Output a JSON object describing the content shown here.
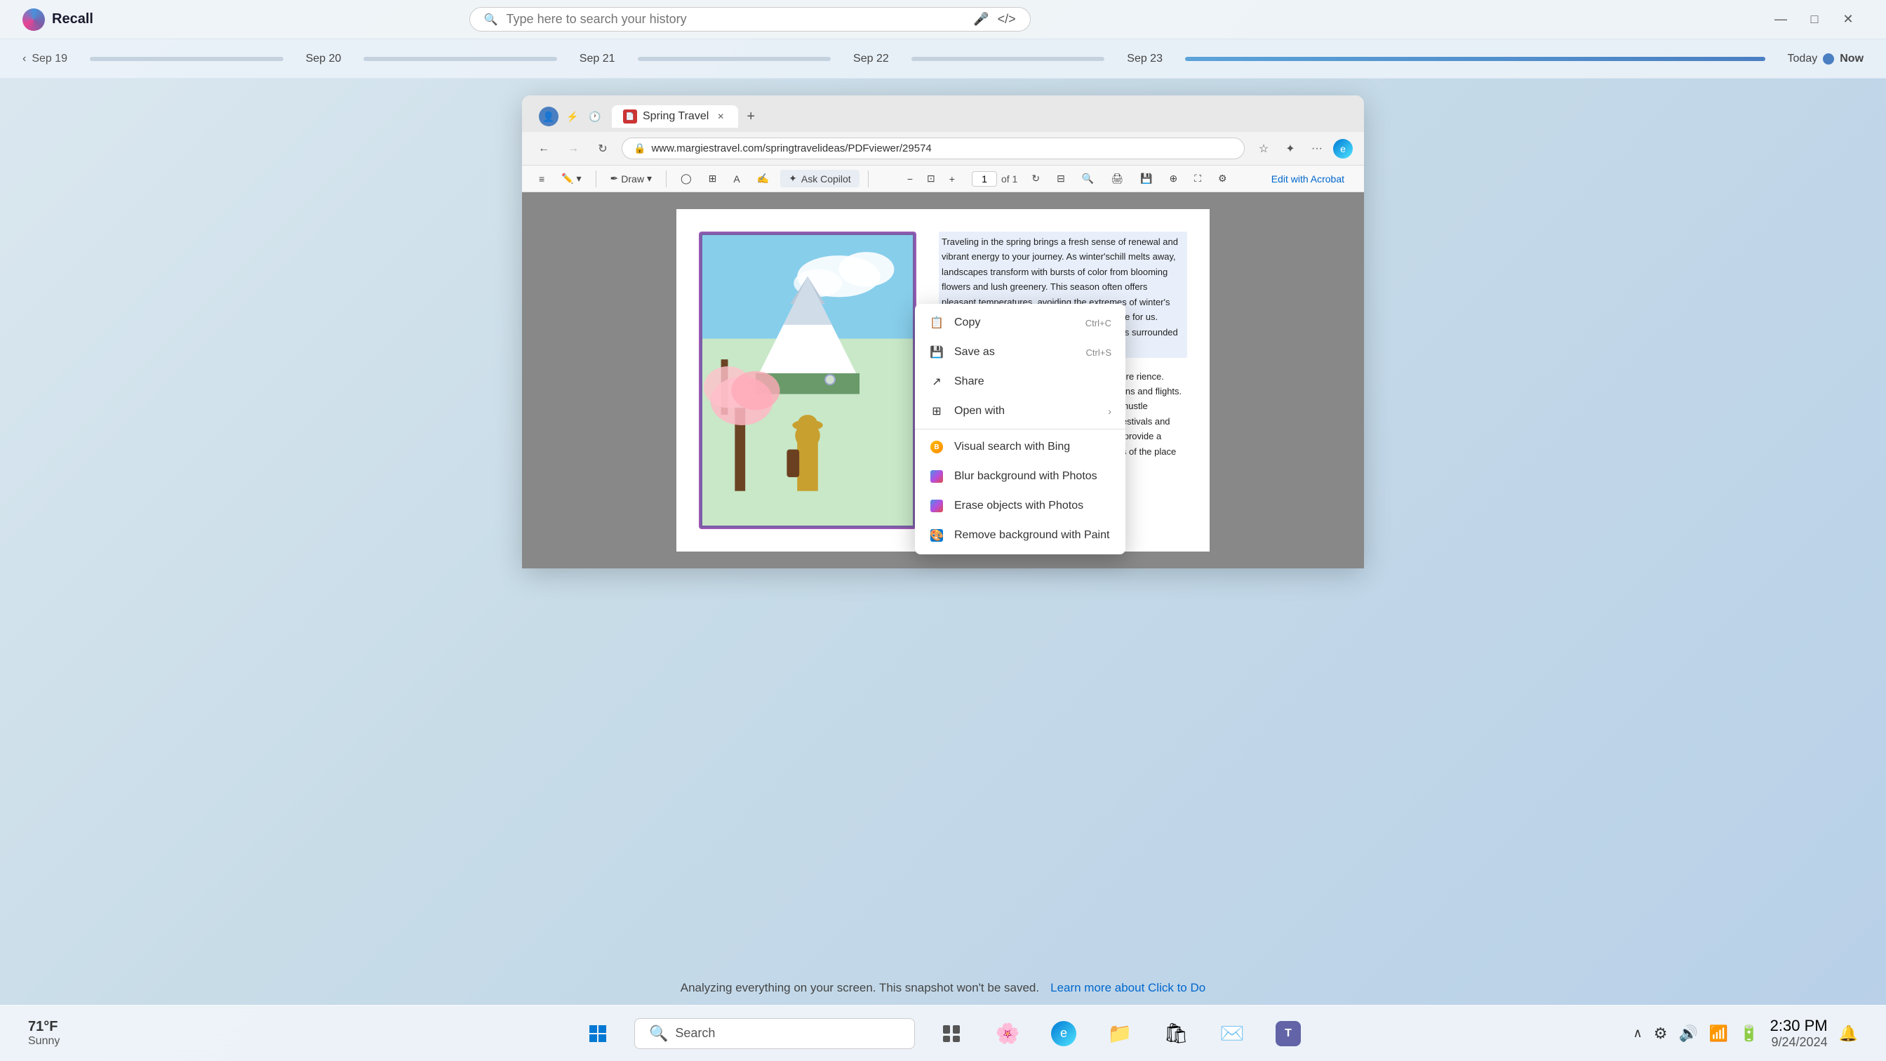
{
  "app": {
    "title": "Recall",
    "search_placeholder": "Type here to search your history"
  },
  "timeline": {
    "dates": [
      "Sep 19",
      "Sep 20",
      "Sep 21",
      "Sep 22",
      "Sep 23",
      "Today",
      "Now"
    ],
    "active": "Today"
  },
  "browser": {
    "tab_title": "Spring Travel",
    "url": "www.margiestravel.com/springtravelideas/PDFviewer/29574",
    "page_number": "1",
    "page_total": "of 1",
    "zoom_label": "Draw",
    "copilot_label": "Ask Copilot",
    "edit_label": "Edit with Acrobat"
  },
  "pdf": {
    "text_content": "Traveling in the spring brings a fresh sense of renewal and vibrant energy to your journey. As winter'schill melts away, landscapes transform with bursts of color from blooming flowers and lush greenery. This season often offers pleasant temperatures, avoiding the extremes of winter's cold and summer's heat, making it comfortable for us. Imagine wandering h a gentle breeze at your s surrounded by nature's",
    "text_content2": "nds to be less crowded nths, allowing for a more rience. Popular tourist ssible, and you might find dations and flights. This ictions, museums, and he overwhelming hustle omething particularly enchanting about local festivals and events celebrating the arrival of spring, which provide a deeper connection to the culture and traditions of the place you're visiting."
  },
  "context_menu": {
    "items": [
      {
        "label": "Copy",
        "shortcut": "Ctrl+C",
        "icon": "copy"
      },
      {
        "label": "Save as",
        "shortcut": "Ctrl+S",
        "icon": "save"
      },
      {
        "label": "Share",
        "shortcut": "",
        "icon": "share"
      },
      {
        "label": "Open with",
        "shortcut": "",
        "icon": "open-with",
        "arrow": true
      },
      {
        "label": "Visual search with Bing",
        "shortcut": "",
        "icon": "bing"
      },
      {
        "label": "Blur background with Photos",
        "shortcut": "",
        "icon": "photos"
      },
      {
        "label": "Erase objects with Photos",
        "shortcut": "",
        "icon": "photos2"
      },
      {
        "label": "Remove background with Paint",
        "shortcut": "",
        "icon": "paint"
      }
    ]
  },
  "bottom_bar": {
    "analyzing_text": "Analyzing everything on your screen. This snapshot won't be saved.",
    "learn_more_text": "Learn more about Click to Do"
  },
  "taskbar": {
    "search_label": "Search",
    "weather_temp": "71°F",
    "weather_desc": "Sunny",
    "clock_time": "2:30 PM",
    "clock_date": "9/24/2024",
    "icons": [
      "windows",
      "search",
      "taskview",
      "widgets",
      "edge",
      "file-explorer",
      "store",
      "mail",
      "teams"
    ]
  },
  "window_controls": {
    "minimize": "—",
    "maximize": "□",
    "close": "✕"
  }
}
